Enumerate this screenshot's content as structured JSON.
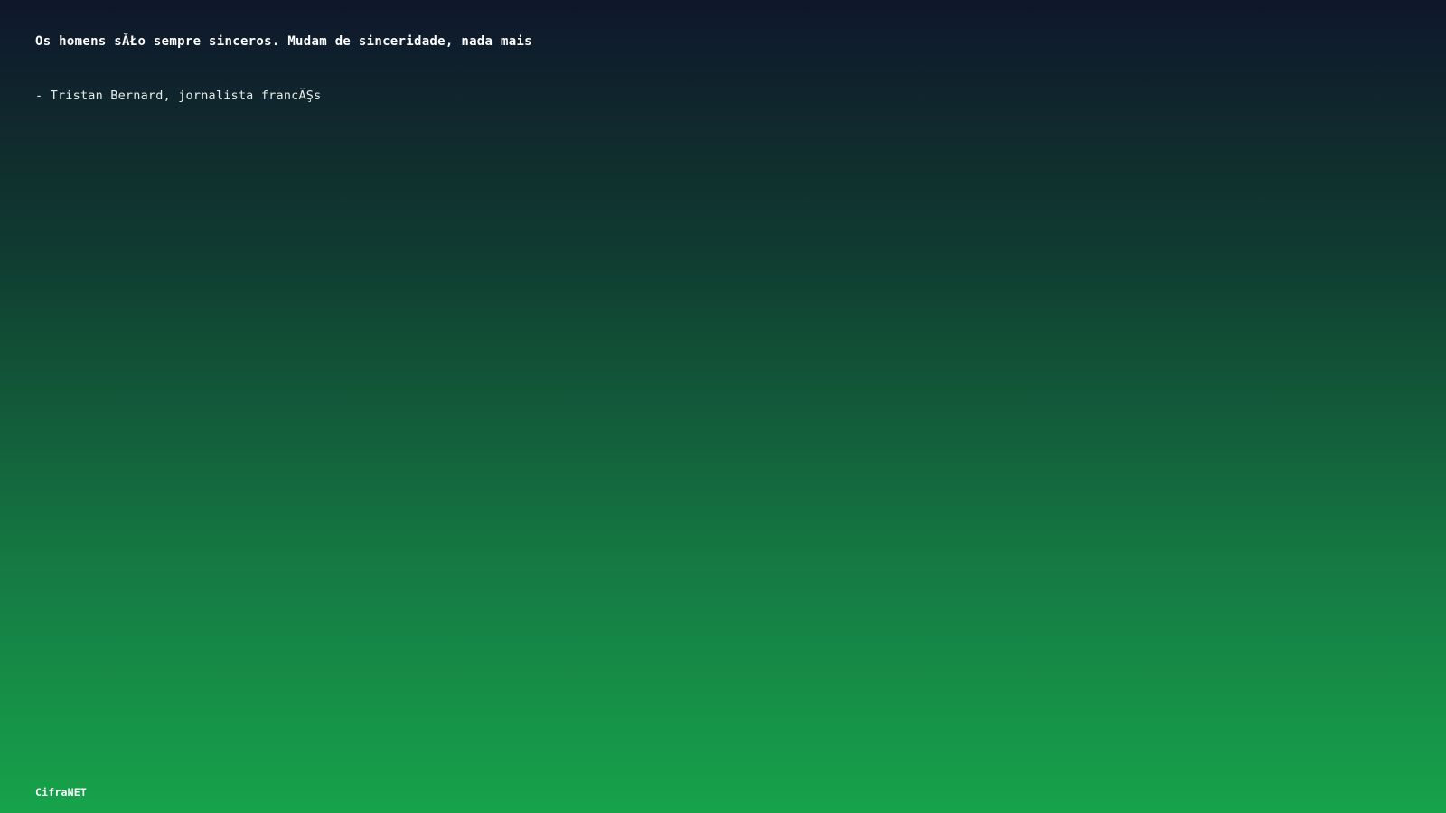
{
  "background": {
    "gradient_top": "#0f172b",
    "gradient_bottom": "#16a34a"
  },
  "quote": {
    "text": "Os homens sĂŁo sempre sinceros. Mudam de sinceridade, nada mais",
    "author": "- Tristan Bernard, jornalista francĂŞs"
  },
  "footer": {
    "brand": "CifraNET"
  }
}
